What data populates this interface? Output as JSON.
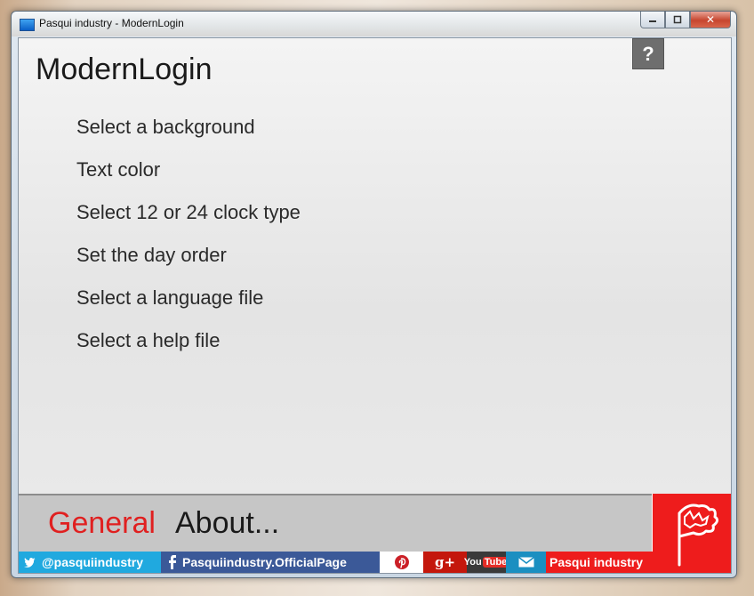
{
  "window": {
    "title": "Pasqui industry - ModernLogin",
    "minimize_icon": "minimize-icon",
    "maximize_icon": "maximize-icon",
    "close_glyph": "✕"
  },
  "app": {
    "title": "ModernLogin",
    "help_label": "?"
  },
  "menu": {
    "items": [
      {
        "label": "Select a background"
      },
      {
        "label": "Text color"
      },
      {
        "label": "Select 12 or 24 clock type"
      },
      {
        "label": "Set the day order"
      },
      {
        "label": "Select a language file"
      },
      {
        "label": "Select a help file"
      }
    ]
  },
  "tabs": {
    "general": "General",
    "about": "About..."
  },
  "social": {
    "twitter": "@pasquiindustry",
    "facebook": "Pasquiindustry.OfficialPage",
    "gplus": "g+",
    "youtube_you": "You",
    "youtube_tube": "Tube",
    "pasqui": "Pasqui industry"
  },
  "colors": {
    "accent_red": "#e02020",
    "twitter_blue": "#20a9df",
    "facebook_blue": "#3b5998"
  }
}
